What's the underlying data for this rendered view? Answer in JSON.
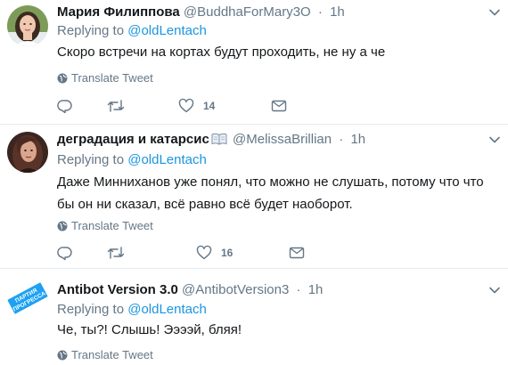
{
  "tweets": [
    {
      "name": "Мария Филиппова",
      "handle": "@BuddhaForMary3O",
      "sep": "·",
      "time": "1h",
      "reply_prefix": "Replying to",
      "reply_to": "@oldLentach",
      "text": "Скоро встречи на кортах будут проходить, не ну а че",
      "translate": "Translate Tweet",
      "likes": "14",
      "avatar_icon": "woman-portrait"
    },
    {
      "name": "деградация и катарсис",
      "handle": "@MelissaBrillian",
      "sep": "·",
      "time": "1h",
      "reply_prefix": "Replying to",
      "reply_to": "@oldLentach",
      "text": "Даже Минниханов уже понял, что можно не слушать, потому что что бы он ни сказал, всё равно всё будет наоборот.",
      "translate": "Translate Tweet",
      "likes": "16",
      "avatar_icon": "woman-portrait-dark",
      "name_emoji": "open-book"
    },
    {
      "name": "Antibot Version 3.0",
      "handle": "@AntibotVersion3",
      "sep": "·",
      "time": "1h",
      "reply_prefix": "Replying to",
      "reply_to": "@oldLentach",
      "text": "Че, ты?! Слышь! Ээээй, бляя!",
      "translate": "Translate Tweet",
      "avatar_icon": "partiya-progressa-logo",
      "avatar_logo_lines": [
        "ПАРТИЯ",
        "ПРОГРЕССА"
      ]
    }
  ],
  "colors": {
    "link": "#1b95e0",
    "secondary": "#657786",
    "text": "#14171a",
    "divider": "#e6ecf0",
    "logo": "#1da1f2"
  }
}
